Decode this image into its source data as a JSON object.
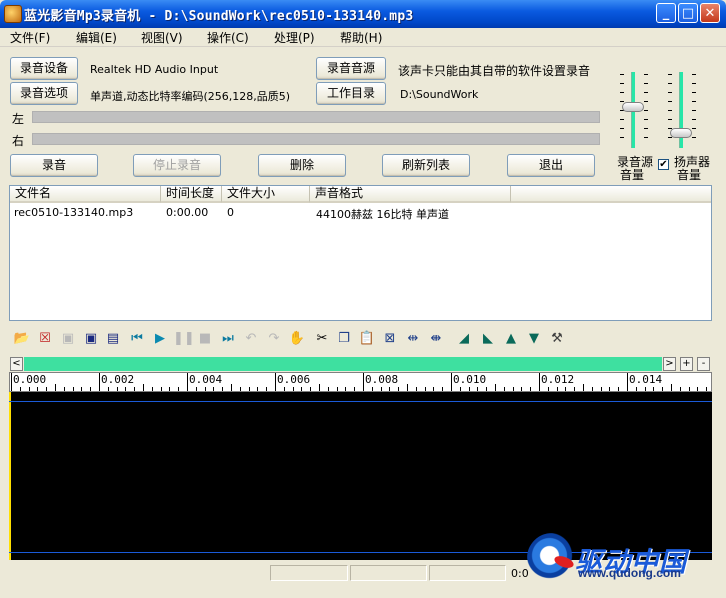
{
  "window": {
    "title": "蓝光影音Mp3录音机 - D:\\SoundWork\\rec0510-133140.mp3",
    "minimize_icon": "minimize-icon",
    "maximize_icon": "maximize-icon",
    "close_icon": "close-icon"
  },
  "menu": [
    {
      "label": "文件(F)"
    },
    {
      "label": "编辑(E)"
    },
    {
      "label": "视图(V)"
    },
    {
      "label": "操作(C)"
    },
    {
      "label": "处理(P)"
    },
    {
      "label": "帮助(H)"
    }
  ],
  "settings": {
    "device_button": "录音设备",
    "device_value": "Realtek HD Audio Input",
    "source_button": "录音音源",
    "source_note": "该声卡只能由其自带的软件设置录音",
    "options_button": "录音选项",
    "options_value": "单声道,动态比特率编码(256,128,品质5)",
    "workdir_button": "工作目录",
    "workdir_value": "D:\\SoundWork"
  },
  "meters": {
    "left_label": "左",
    "right_label": "右"
  },
  "volume": {
    "source_label_1": "录音源",
    "source_label_2": "音量",
    "source_level": 0.55,
    "speaker_label_1": "扬声器",
    "speaker_label_2": "音量",
    "speaker_level": 0.15,
    "speaker_checked": true
  },
  "actions": {
    "record": "录音",
    "stop": "停止录音",
    "delete": "删除",
    "refresh": "刷新列表",
    "exit": "退出"
  },
  "file_list": {
    "columns": [
      "文件名",
      "时间长度",
      "文件大小",
      "声音格式"
    ],
    "rows": [
      {
        "name": "rec0510-133140.mp3",
        "duration": "0:00.00",
        "size": "0",
        "format": "44100赫兹 16比特 单声道"
      }
    ]
  },
  "toolbar": [
    "open-folder-icon",
    "close-file-icon",
    "save-disabled-icon",
    "save-icon",
    "save-as-icon",
    "go-start-icon",
    "play-icon",
    "pause-icon",
    "stop-icon",
    "go-end-icon",
    "undo-icon",
    "redo-icon",
    "hand-icon",
    "cut-icon",
    "copy-icon",
    "paste-icon",
    "mix-paste-icon",
    "select-range-icon",
    "zoom-range-icon",
    "fade-in-icon",
    "fade-out-icon",
    "volume-up-icon",
    "volume-down-icon",
    "effect-icon"
  ],
  "scroll": {
    "left_arrow": "<",
    "right_arrow": ">",
    "zoom_in": "+",
    "zoom_out": "-"
  },
  "ruler": {
    "labels": [
      "0.000",
      "0.002",
      "0.004",
      "0.006",
      "0.008",
      "0.010",
      "0.012",
      "0.014"
    ]
  },
  "status": {
    "time": "0:0"
  },
  "watermark": {
    "text": "驱动中国",
    "url": "www.qudong.com"
  }
}
